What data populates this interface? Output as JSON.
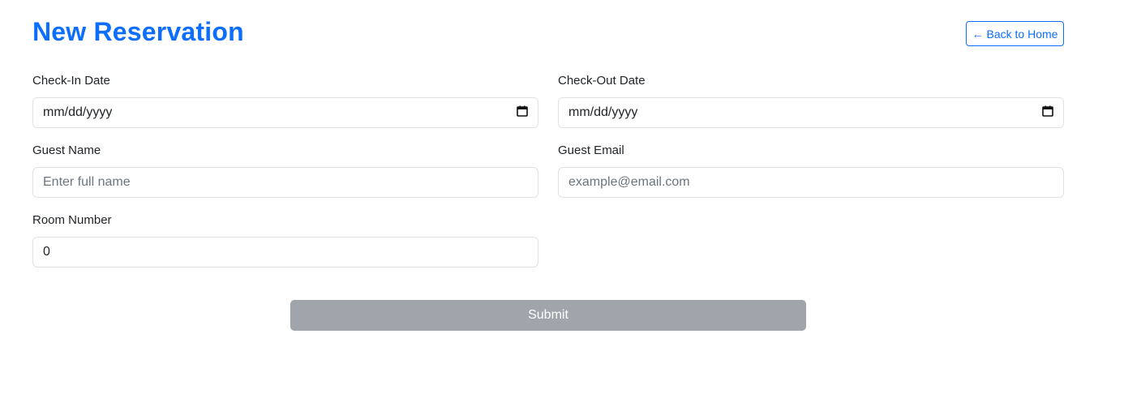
{
  "header": {
    "title": "New Reservation",
    "back_button_arrow": "←",
    "back_button_label": "Back to Home"
  },
  "form": {
    "check_in": {
      "label": "Check-In Date",
      "value": "mm/dd/yyyy",
      "icon": "calendar-icon"
    },
    "check_out": {
      "label": "Check-Out Date",
      "value": "mm/dd/yyyy",
      "icon": "calendar-icon"
    },
    "guest_name": {
      "label": "Guest Name",
      "placeholder": "Enter full name"
    },
    "guest_email": {
      "label": "Guest Email",
      "placeholder": "example@email.com"
    },
    "room_number": {
      "label": "Room Number",
      "value": "0"
    },
    "submit_label": "Submit"
  },
  "colors": {
    "accent": "#0d6efd",
    "submit_disabled": "#a0a4ab",
    "input_border": "#dee2e6"
  }
}
